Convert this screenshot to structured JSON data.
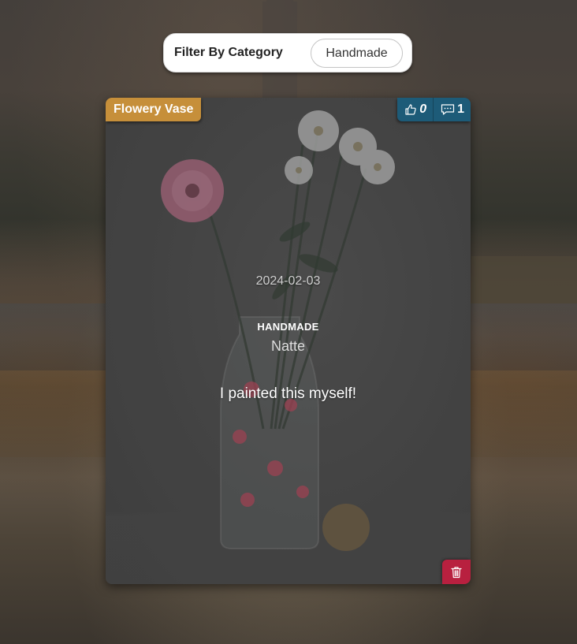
{
  "filter": {
    "label": "Filter By Category",
    "selected": "Handmade"
  },
  "post": {
    "title": "Flowery Vase",
    "likes": "0",
    "comments": "1",
    "date": "2024-02-03",
    "category": "HANDMADE",
    "author": "Natte",
    "description": "I painted this myself!"
  },
  "icons": {
    "like": "thumbs-up-icon",
    "comment": "comment-icon",
    "delete": "trash-icon"
  },
  "colors": {
    "title_badge": "#c68f3a",
    "stats_bar": "#1d5b78",
    "delete_button": "#b8203f"
  }
}
